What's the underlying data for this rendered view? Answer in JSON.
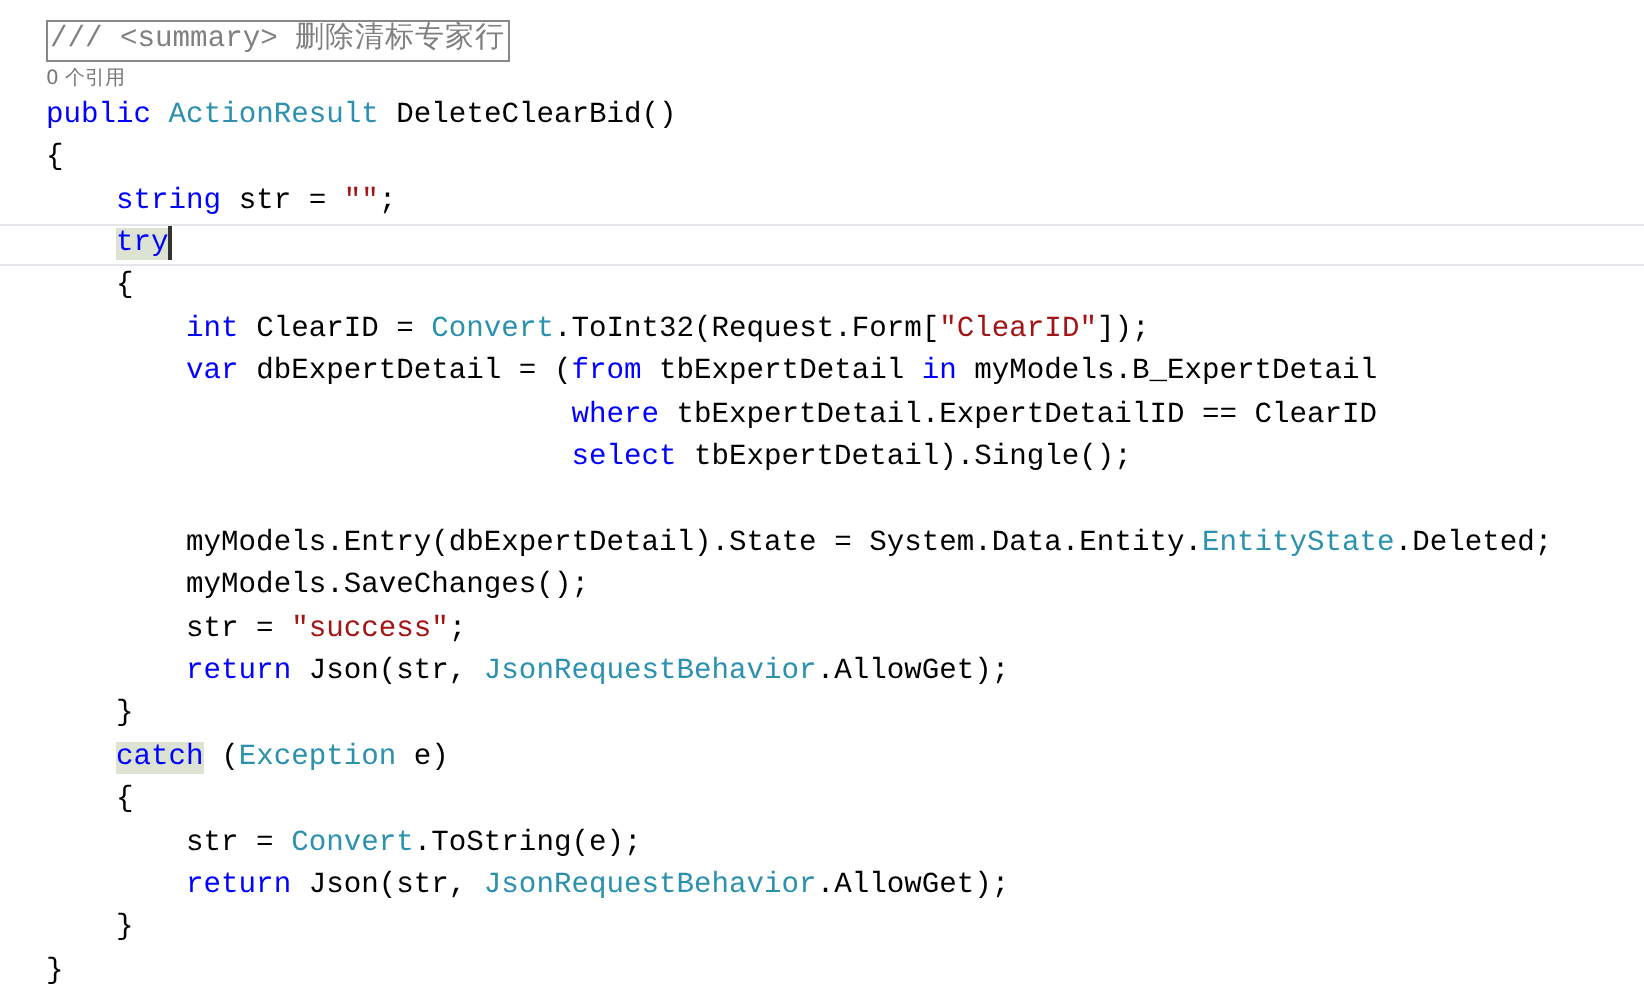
{
  "summary_comment": {
    "text": "/// <summary> 删除清标专家行",
    "boxed": true
  },
  "reference_count": "0 个引用",
  "code_lines": [
    {
      "current": false,
      "tokens": [
        {
          "kind": "keyword",
          "text": "public"
        },
        {
          "kind": "type",
          "text": " ActionResult"
        },
        {
          "kind": "plain",
          "text": " DeleteClearBid()"
        }
      ]
    },
    {
      "current": false,
      "tokens": [
        {
          "kind": "plain",
          "text": "{"
        }
      ],
      "children": [
        {
          "current": false,
          "tokens": [
            {
              "kind": "keyword",
              "text": "string"
            },
            {
              "kind": "plain",
              "text": " str = "
            },
            {
              "kind": "string",
              "text": "\"\""
            },
            {
              "kind": "plain",
              "text": ";"
            }
          ]
        },
        {
          "current": true,
          "tokens": [
            {
              "kind": "keyword",
              "text": "try",
              "highlighted": true
            }
          ]
        },
        {
          "current": false,
          "tokens": [
            {
              "kind": "plain",
              "text": "{"
            }
          ],
          "children": [
            {
              "current": false,
              "tokens": [
                {
                  "kind": "keyword",
                  "text": "int"
                },
                {
                  "kind": "plain",
                  "text": " ClearID = "
                },
                {
                  "kind": "type",
                  "text": "Convert"
                },
                {
                  "kind": "plain",
                  "text": ".ToInt32(Request.Form["
                },
                {
                  "kind": "string",
                  "text": "\"ClearID\""
                },
                {
                  "kind": "plain",
                  "text": "]);"
                }
              ]
            },
            {
              "current": false,
              "tokens": [
                {
                  "kind": "keyword",
                  "text": "var"
                },
                {
                  "kind": "plain",
                  "text": " dbExpertDetail = ("
                },
                {
                  "kind": "keyword",
                  "text": "from"
                },
                {
                  "kind": "plain",
                  "text": " tbExpertDetail "
                },
                {
                  "kind": "keyword",
                  "text": "in"
                },
                {
                  "kind": "plain",
                  "text": " myModels.B_ExpertDetail"
                }
              ],
              "children": [
                {
                  "current": false,
                  "tokens": [
                    {
                      "kind": "keyword",
                      "text": "where"
                    },
                    {
                      "kind": "plain",
                      "text": " tbExpertDetail.ExpertDetailID == ClearID"
                    }
                  ]
                },
                {
                  "current": false,
                  "tokens": [
                    {
                      "kind": "keyword",
                      "text": "select"
                    },
                    {
                      "kind": "plain",
                      "text": " tbExpertDetail).Single();"
                    }
                  ]
                }
              ]
            },
            {
              "current": false
            },
            {
              "current": false,
              "tokens": [
                {
                  "kind": "plain",
                  "text": "myModels.Entry(dbExpertDetail).State = System.Data.Entity."
                },
                {
                  "kind": "type",
                  "text": "EntityState"
                },
                {
                  "kind": "plain",
                  "text": ".Deleted;"
                }
              ]
            },
            {
              "current": false,
              "tokens": [
                {
                  "kind": "plain",
                  "text": "myModels.SaveChanges();"
                }
              ]
            },
            {
              "current": false,
              "tokens": [
                {
                  "kind": "plain",
                  "text": "str = "
                },
                {
                  "kind": "string",
                  "text": "\"success\""
                },
                {
                  "kind": "plain",
                  "text": ";"
                }
              ]
            },
            {
              "current": false,
              "tokens": [
                {
                  "kind": "keyword",
                  "text": "return"
                },
                {
                  "kind": "plain",
                  "text": " Json(str, "
                },
                {
                  "kind": "type",
                  "text": "JsonRequestBehavior"
                },
                {
                  "kind": "plain",
                  "text": ".AllowGet);"
                }
              ]
            }
          ]
        },
        {
          "current": false,
          "tokens": [
            {
              "kind": "plain",
              "text": "}"
            }
          ]
        },
        {
          "current": false,
          "tokens": [
            {
              "kind": "keyword",
              "text": "catch",
              "highlighted": true
            },
            {
              "kind": "plain",
              "text": " ("
            },
            {
              "kind": "type",
              "text": "Exception"
            },
            {
              "kind": "plain",
              "text": " e)"
            }
          ]
        },
        {
          "current": false,
          "tokens": [
            {
              "kind": "plain",
              "text": "{"
            }
          ],
          "children": [
            {
              "current": false,
              "tokens": [
                {
                  "kind": "plain",
                  "text": "str = "
                },
                {
                  "kind": "type",
                  "text": "Convert"
                },
                {
                  "kind": "plain",
                  "text": ".ToString(e);"
                }
              ]
            },
            {
              "current": false,
              "tokens": [
                {
                  "kind": "keyword",
                  "text": "return"
                },
                {
                  "kind": "plain",
                  "text": " Json(str, "
                },
                {
                  "kind": "type",
                  "text": "JsonRequestBehavior"
                },
                {
                  "kind": "plain",
                  "text": ".AllowGet);"
                }
              ]
            }
          ]
        },
        {
          "current": false,
          "tokens": [
            {
              "kind": "plain",
              "text": "}"
            }
          ]
        }
      ]
    },
    {
      "current": false,
      "tokens": [
        {
          "kind": "plain",
          "text": "}"
        }
      ]
    }
  ]
}
